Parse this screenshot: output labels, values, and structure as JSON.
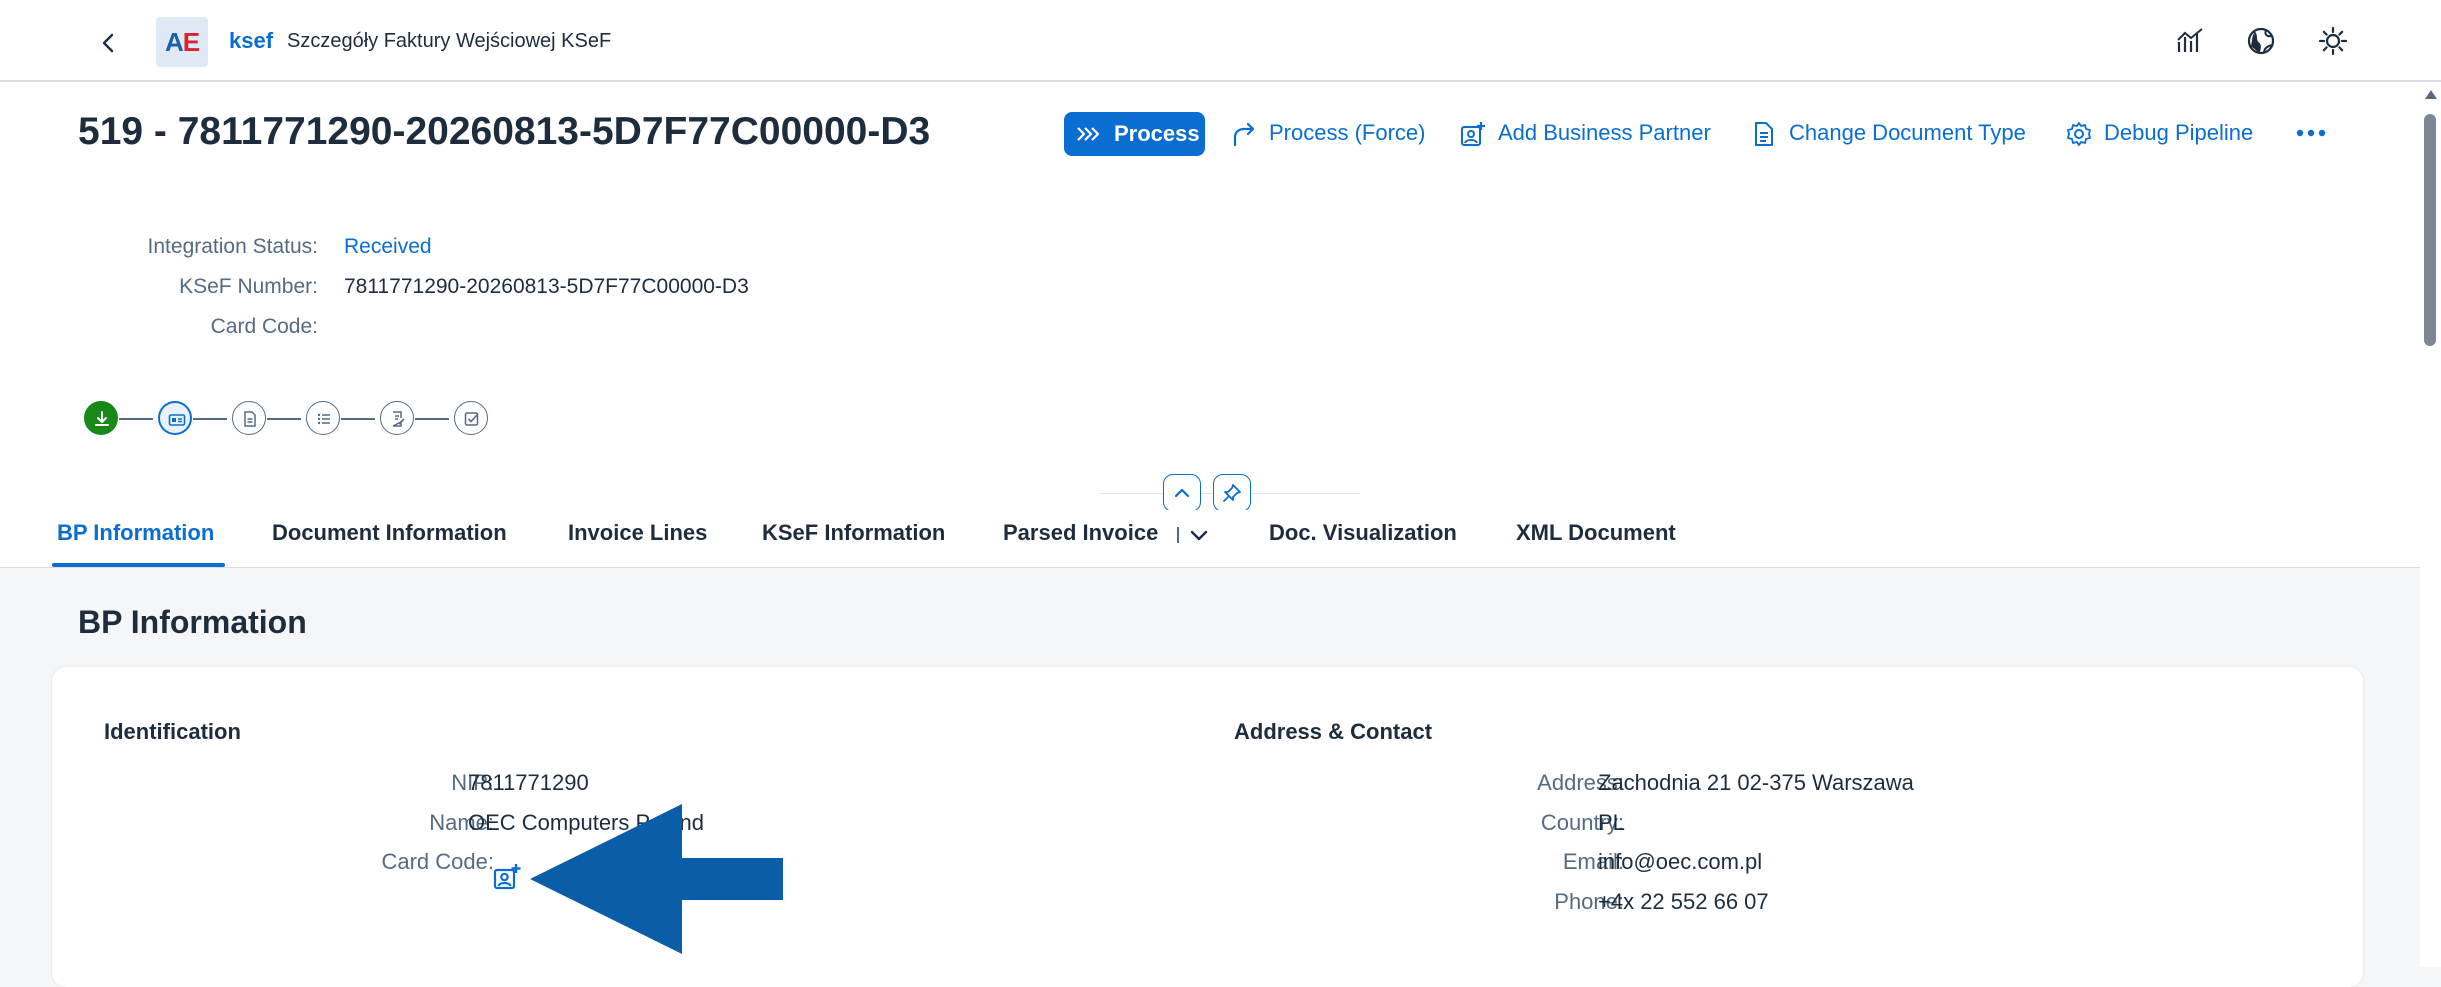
{
  "shell": {
    "logo_part1": "A",
    "logo_part2": "E",
    "app_short": "ksef",
    "app_title": "Szczegóły Faktury Wejściowej KSeF",
    "icons": [
      "chevron-left-icon",
      "analytics-icon",
      "globe-icon",
      "theme-sun-icon"
    ]
  },
  "header": {
    "title": "519 - 7811771290-20260813-5D7F77C00000-D3",
    "actions": {
      "process": "Process",
      "process_force": "Process (Force)",
      "add_bp": "Add Business Partner",
      "change_doc_type": "Change Document Type",
      "debug": "Debug Pipeline"
    },
    "fields": {
      "integration_status_label": "Integration Status:",
      "integration_status_value": "Received",
      "ksef_number_label": "KSeF Number:",
      "ksef_number_value": "7811771290-20260813-5D7F77C00000-D3",
      "card_code_label": "Card Code:",
      "card_code_value": ""
    },
    "steps": [
      {
        "icon": "download-icon",
        "state": "done"
      },
      {
        "icon": "id-card-icon",
        "state": "current"
      },
      {
        "icon": "document-icon",
        "state": "pending"
      },
      {
        "icon": "list-icon",
        "state": "pending"
      },
      {
        "icon": "document-edit-icon",
        "state": "pending"
      },
      {
        "icon": "checkbox-icon",
        "state": "pending"
      }
    ]
  },
  "tabs": [
    {
      "label": "BP Information",
      "active": true
    },
    {
      "label": "Document Information"
    },
    {
      "label": "Invoice Lines"
    },
    {
      "label": "KSeF Information"
    },
    {
      "label": "Parsed Invoice"
    },
    {
      "label": "Doc. Visualization"
    },
    {
      "label": "XML Document"
    }
  ],
  "section": {
    "title": "BP Information",
    "identification": {
      "title": "Identification",
      "nip_label": "NIP:",
      "nip_value": "7811771290",
      "name_label": "Name:",
      "name_value": "OEC Computers Poland",
      "card_code_label": "Card Code:"
    },
    "address": {
      "title": "Address & Contact",
      "address_label": "Address:",
      "address_value": "Zachodnia 21 02-375 Warszawa",
      "country_label": "Country:",
      "country_value": "PL",
      "email_label": "Email:",
      "email_value": "info@oec.com.pl",
      "phone_label": "Phone:",
      "phone_value": "+4x 22 552 66 07"
    }
  },
  "colors": {
    "brand": "#0a6ed1",
    "text": "#1d2d3e",
    "label": "#556b82",
    "success": "#188918",
    "annotation_arrow": "#0a5ea8"
  }
}
